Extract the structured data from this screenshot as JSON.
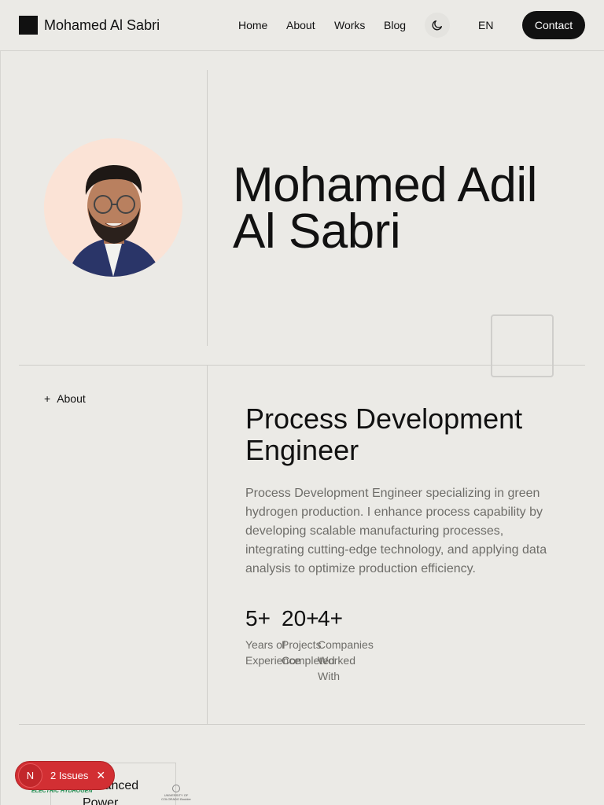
{
  "header": {
    "brand_name": "Mohamed Al Sabri",
    "nav": [
      "Home",
      "About",
      "Works",
      "Blog"
    ],
    "language": "EN",
    "contact_label": "Contact"
  },
  "hero": {
    "name_line1": "Mohamed Adil",
    "name_line2": "Al Sabri"
  },
  "about": {
    "section_label": "About",
    "role_title_line1": "Process Development",
    "role_title_line2": "Engineer",
    "bio": "Process Development Engineer specializing in green hydrogen production. I enhance process capability by developing scalable manufacturing processes, integrating cutting-edge technology, and applying data analysis to optimize production efficiency.",
    "stats": [
      {
        "value": "5+",
        "label": "Years of Experience"
      },
      {
        "value": "20+",
        "label": "Projects Completed"
      },
      {
        "value": "4+",
        "label": "Companies Worked With"
      }
    ]
  },
  "bottom": {
    "card_title": "Advanced Power Conversion",
    "logo_left": "ELECTRIC HYDROGEN",
    "logo_right": "UNIVERSITY OF COLORADO Boulder"
  },
  "issues_badge": {
    "letter": "N",
    "text": "2 Issues"
  },
  "colors": {
    "background": "#ebeae6",
    "text": "#111111",
    "muted": "#6e6d69",
    "issues": "#d22f33"
  }
}
